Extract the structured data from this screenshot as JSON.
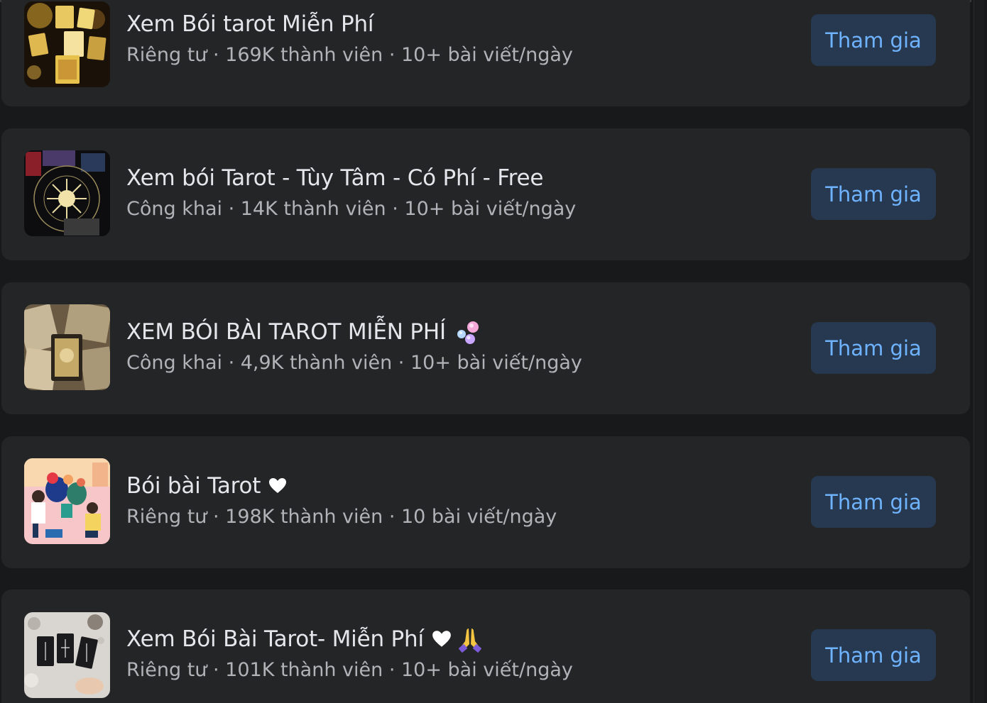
{
  "groups": [
    {
      "name": "Xem Bói tarot Miễn Phí",
      "meta": "Riêng tư · 169K thành viên · 10+ bài viết/ngày",
      "join_label": "Tham gia",
      "thumbnail_icon": "tarot-cards-thumbnail"
    },
    {
      "name": "Xem bói Tarot - Tùy Tâm - Có Phí - Free",
      "meta": "Công khai · 14K thành viên · 10+ bài viết/ngày",
      "join_label": "Tham gia",
      "thumbnail_icon": "zodiac-sun-thumbnail"
    },
    {
      "name": "XEM BÓI BÀI TAROT MIỄN PHÍ",
      "meta": "Công khai · 4,9K thành viên · 10+ bài viết/ngày",
      "join_label": "Tham gia",
      "thumbnail_icon": "tarot-deck-thumbnail",
      "title_icon": "bubbles-emoji-icon"
    },
    {
      "name": "Bói bài Tarot",
      "meta": "Riêng tư · 198K thành viên · 10 bài viết/ngày",
      "join_label": "Tham gia",
      "thumbnail_icon": "gardening-illustration-thumbnail",
      "title_icon": "white-heart-icon"
    },
    {
      "name": "Xem Bói Bài Tarot- Miễn Phí",
      "meta": "Riêng tư · 101K thành viên · 10+ bài viết/ngày",
      "join_label": "Tham gia",
      "thumbnail_icon": "tarot-spread-thumbnail",
      "title_icon": "white-heart-icon",
      "title_icon_2": "folded-hands-emoji-icon"
    }
  ],
  "colors": {
    "page_background": "#18191a",
    "card_background": "#242526",
    "title_text": "#e4e6eb",
    "meta_text": "#b0b3b8",
    "button_background": "#263951",
    "button_text": "#6fb3ff"
  }
}
